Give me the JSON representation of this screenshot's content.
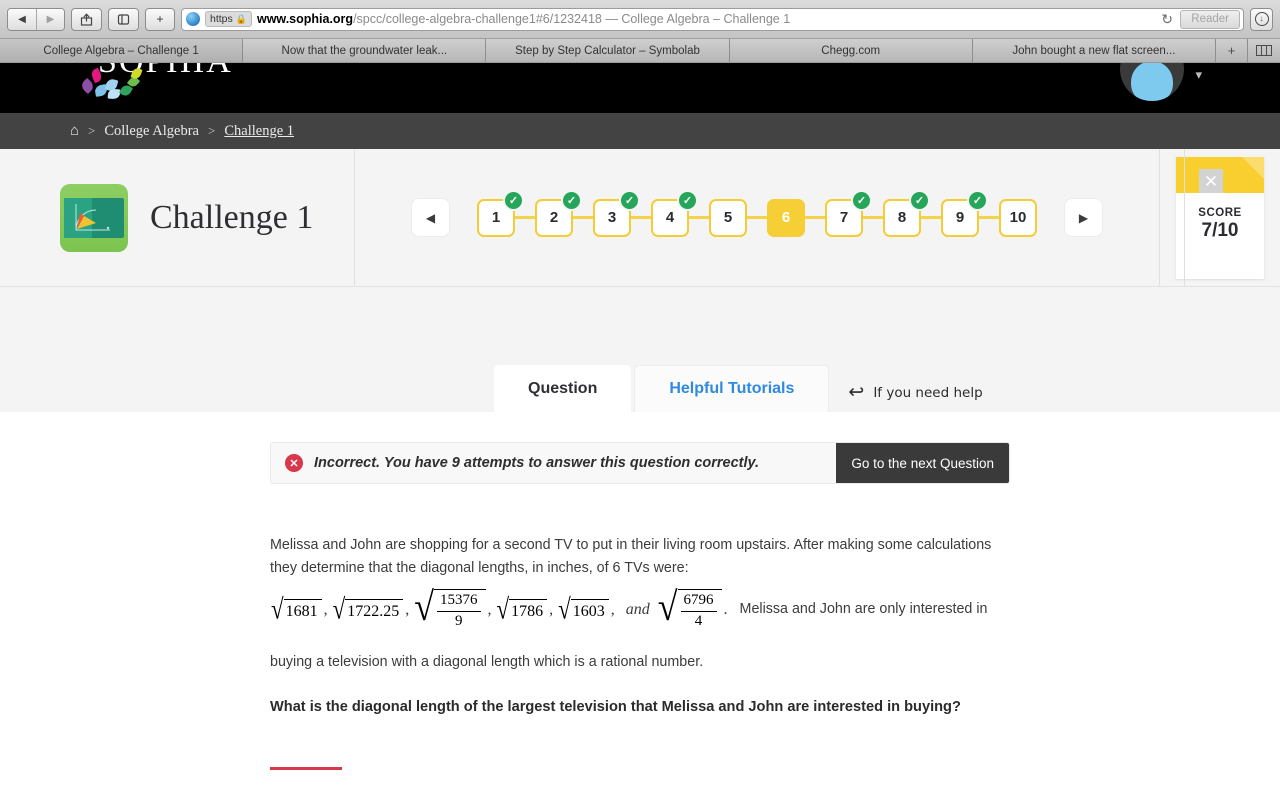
{
  "browser": {
    "nav": {
      "back": "◀",
      "forward": "▶",
      "share": "share-icon",
      "sidebar": "sidebar-icon",
      "add": "+"
    },
    "url": {
      "scheme_label": "https",
      "lock": "🔒",
      "host": "www.sophia.org",
      "path": "/spcc/college-algebra-challenge1#6/1232418",
      "separator": " — ",
      "page_title": "College Algebra – Challenge 1"
    },
    "reload": "↻",
    "reader_label": "Reader",
    "downloads": "↓",
    "tabs": [
      {
        "label": "College Algebra – Challenge 1",
        "active": true
      },
      {
        "label": "Now that the groundwater leak...",
        "active": false
      },
      {
        "label": "Step by Step Calculator – Symbolab",
        "active": false
      },
      {
        "label": "Chegg.com",
        "active": false
      },
      {
        "label": "John bought a new flat screen...",
        "active": false
      }
    ],
    "tab_controls": {
      "new_tab": "+",
      "show_all_tabs": "tabs-overview-icon"
    }
  },
  "site": {
    "logo_text": "SOPHIA",
    "avatar": "user-avatar",
    "caret": "▾"
  },
  "breadcrumb": {
    "home": "⌂",
    "separator": ">",
    "items": [
      {
        "label": "College Algebra",
        "current": false
      },
      {
        "label": "Challenge 1",
        "current": true
      }
    ]
  },
  "challenge": {
    "title": "Challenge 1",
    "icon": "challenge-chalkboard-icon",
    "prev_arrow": "◀",
    "next_arrow": "▶",
    "steps": [
      {
        "number": "1",
        "completed": true,
        "active": false
      },
      {
        "number": "2",
        "completed": true,
        "active": false
      },
      {
        "number": "3",
        "completed": true,
        "active": false
      },
      {
        "number": "4",
        "completed": true,
        "active": false
      },
      {
        "number": "5",
        "completed": false,
        "active": false
      },
      {
        "number": "6",
        "completed": false,
        "active": true
      },
      {
        "number": "7",
        "completed": true,
        "active": false
      },
      {
        "number": "8",
        "completed": true,
        "active": false
      },
      {
        "number": "9",
        "completed": true,
        "active": false
      },
      {
        "number": "10",
        "completed": false,
        "active": false
      }
    ],
    "check_glyph": "✓",
    "score": {
      "label": "SCORE",
      "value": "7/10"
    },
    "close": "✕"
  },
  "tabs": {
    "question": "Question",
    "helpful_tutorials": "Helpful Tutorials",
    "help_arrow": "↩",
    "help_text": "If you need help"
  },
  "alert": {
    "icon": "✕",
    "message": "Incorrect. You have 9 attempts to answer this question correctly.",
    "next_button": "Go to the next Question"
  },
  "question": {
    "paragraph_1": "Melissa and John are shopping for a second TV to put in their living room upstairs. After making some calculations they determine that the diagonal lengths, in inches, of 6 TVs were:",
    "radicals": [
      {
        "type": "plain",
        "value": "1681"
      },
      {
        "type": "plain",
        "value": "1722.25"
      },
      {
        "type": "fraction",
        "numerator": "15376",
        "denominator": "9"
      },
      {
        "type": "plain",
        "value": "1786"
      },
      {
        "type": "plain",
        "value": "1603"
      },
      {
        "type": "fraction",
        "numerator": "6796",
        "denominator": "4"
      }
    ],
    "comma": ",",
    "and_word": "and",
    "period": ".",
    "inline_tail": "Melissa and John are only interested in",
    "paragraph_2": "buying  a television with a diagonal length which is a rational number.",
    "prompt": "What is the diagonal length of the largest television that Melissa and John are interested in buying?"
  },
  "colors": {
    "accent_yellow": "#f6cf36",
    "check_green": "#25a65b",
    "link_blue": "#2f8ae0",
    "error_red": "#d8384b",
    "header_black": "#000000",
    "breadcrumb_gray": "#434343"
  }
}
